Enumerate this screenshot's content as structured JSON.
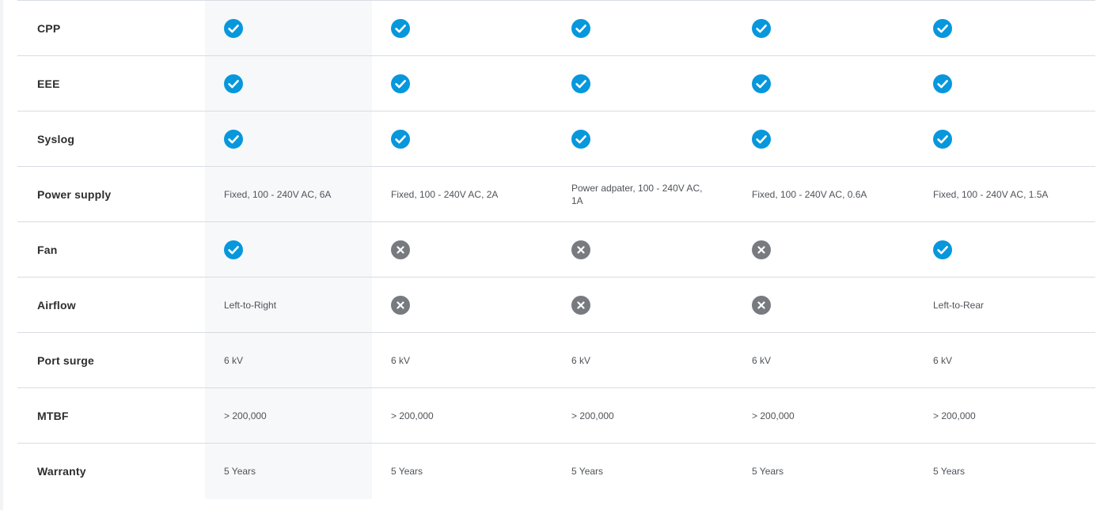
{
  "comparison_table": {
    "rows": [
      {
        "label": "CPP",
        "cells": [
          {
            "kind": "check",
            "icon": "check-circle-icon"
          },
          {
            "kind": "check",
            "icon": "check-circle-icon"
          },
          {
            "kind": "check",
            "icon": "check-circle-icon"
          },
          {
            "kind": "check",
            "icon": "check-circle-icon"
          },
          {
            "kind": "check",
            "icon": "check-circle-icon"
          }
        ]
      },
      {
        "label": "EEE",
        "cells": [
          {
            "kind": "check",
            "icon": "check-circle-icon"
          },
          {
            "kind": "check",
            "icon": "check-circle-icon"
          },
          {
            "kind": "check",
            "icon": "check-circle-icon"
          },
          {
            "kind": "check",
            "icon": "check-circle-icon"
          },
          {
            "kind": "check",
            "icon": "check-circle-icon"
          }
        ]
      },
      {
        "label": "Syslog",
        "cells": [
          {
            "kind": "check",
            "icon": "check-circle-icon"
          },
          {
            "kind": "check",
            "icon": "check-circle-icon"
          },
          {
            "kind": "check",
            "icon": "check-circle-icon"
          },
          {
            "kind": "check",
            "icon": "check-circle-icon"
          },
          {
            "kind": "check",
            "icon": "check-circle-icon"
          }
        ]
      },
      {
        "label": "Power supply",
        "cells": [
          {
            "kind": "text",
            "text": "Fixed, 100 - 240V AC, 6A"
          },
          {
            "kind": "text",
            "text": "Fixed, 100 - 240V AC, 2A"
          },
          {
            "kind": "text",
            "text": "Power adpater, 100 - 240V AC, 1A"
          },
          {
            "kind": "text",
            "text": "Fixed, 100 - 240V AC, 0.6A"
          },
          {
            "kind": "text",
            "text": "Fixed, 100 - 240V AC, 1.5A"
          }
        ]
      },
      {
        "label": "Fan",
        "cells": [
          {
            "kind": "check",
            "icon": "check-circle-icon"
          },
          {
            "kind": "cross",
            "icon": "x-circle-icon"
          },
          {
            "kind": "cross",
            "icon": "x-circle-icon"
          },
          {
            "kind": "cross",
            "icon": "x-circle-icon"
          },
          {
            "kind": "check",
            "icon": "check-circle-icon"
          }
        ]
      },
      {
        "label": "Airflow",
        "cells": [
          {
            "kind": "text",
            "text": "Left-to-Right"
          },
          {
            "kind": "cross",
            "icon": "x-circle-icon"
          },
          {
            "kind": "cross",
            "icon": "x-circle-icon"
          },
          {
            "kind": "cross",
            "icon": "x-circle-icon"
          },
          {
            "kind": "text",
            "text": "Left-to-Rear"
          }
        ]
      },
      {
        "label": "Port surge",
        "cells": [
          {
            "kind": "text",
            "text": "6 kV"
          },
          {
            "kind": "text",
            "text": "6 kV"
          },
          {
            "kind": "text",
            "text": "6 kV"
          },
          {
            "kind": "text",
            "text": "6 kV"
          },
          {
            "kind": "text",
            "text": "6 kV"
          }
        ]
      },
      {
        "label": "MTBF",
        "cells": [
          {
            "kind": "text",
            "text": "> 200,000"
          },
          {
            "kind": "text",
            "text": "> 200,000"
          },
          {
            "kind": "text",
            "text": "> 200,000"
          },
          {
            "kind": "text",
            "text": "> 200,000"
          },
          {
            "kind": "text",
            "text": "> 200,000"
          }
        ]
      },
      {
        "label": "Warranty",
        "cells": [
          {
            "kind": "text",
            "text": "5 Years"
          },
          {
            "kind": "text",
            "text": "5 Years"
          },
          {
            "kind": "text",
            "text": "5 Years"
          },
          {
            "kind": "text",
            "text": "5 Years"
          },
          {
            "kind": "text",
            "text": "5 Years"
          }
        ]
      }
    ]
  },
  "colors": {
    "check": "#0797dc",
    "cross": "#777b80",
    "highlight_column": "#f6f8fa",
    "divider": "#d8dde2"
  }
}
